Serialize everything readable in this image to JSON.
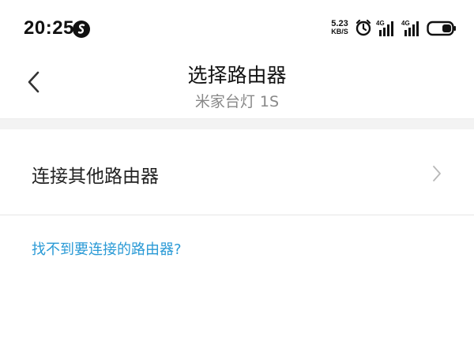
{
  "status_bar": {
    "time": "20:25",
    "app_icon": "s-app-icon",
    "net_speed_value": "5.23",
    "net_speed_unit": "KB/S",
    "alarm_icon": "alarm-icon",
    "signal_1_label": "4G",
    "signal_2_label": "4G",
    "battery_icon": "battery-icon"
  },
  "header": {
    "back_icon": "chevron-left-icon",
    "title": "选择路由器",
    "subtitle": "米家台灯 1S"
  },
  "list": {
    "items": [
      {
        "label": "连接其他路由器",
        "icon": "chevron-right-icon"
      }
    ]
  },
  "help": {
    "link_text": "找不到要连接的路由器?"
  },
  "colors": {
    "link": "#2a9ad6",
    "subtitle": "#888888",
    "divider_band": "#f3f3f3"
  }
}
